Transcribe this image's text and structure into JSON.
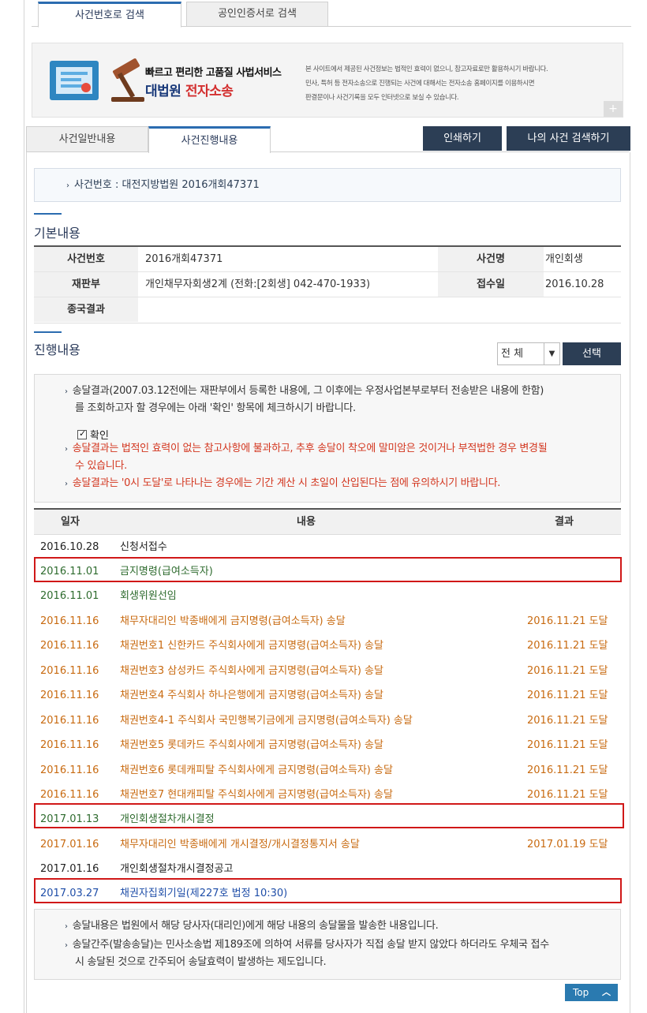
{
  "top_tabs": {
    "case_search": "사건번호로 검색",
    "cert_search": "공인인증서로 검색"
  },
  "banner": {
    "line1": "빠르고 편리한 고품질 사법서비스",
    "brand_prefix": "대법원",
    "brand_suffix": "전자소송",
    "desc1": "본 사이트에서 제공된 사건정보는 법적인 효력이 없으니, 참고자료로만 활용하시기 바랍니다.",
    "desc2": "민사, 특허 등 전자소송으로 진행되는 사건에 대해서는 전자소송 홈페이지를 이용하시면",
    "desc3": "판결문이나 사건기록을 모두 인터넷으로 보실 수 있습니다.",
    "plus": "+"
  },
  "sub_tabs": {
    "general": "사건일반내용",
    "progress": "사건진행내용"
  },
  "buttons": {
    "print": "인쇄하기",
    "my_search": "나의 사건 검색하기",
    "select": "선택",
    "top": "Top"
  },
  "case_box": "사건번호 : 대전지방법원 2016개회47371",
  "basic": {
    "title": "기본내용",
    "rows": [
      {
        "label1": "사건번호",
        "value1": "2016개회47371",
        "label2": "사건명",
        "value2": "개인회생"
      },
      {
        "label1": "재판부",
        "value1": "개인채무자회생2계 (전화:[2회생] 042-470-1933)",
        "label2": "접수일",
        "value2": "2016.10.28"
      },
      {
        "label1": "종국결과",
        "value1": "",
        "label2": "",
        "value2": ""
      }
    ]
  },
  "progress": {
    "title": "진행내용",
    "filter_value": "전 체",
    "notes": {
      "n1a": "송달결과(2007.03.12전에는 재판부에서 등록한 내용에, 그 이후에는 우정사업본부로부터 전송받은 내용에 한함)",
      "n1b": "를 조회하고자 할 경우에는 아래 '확인' 항목에 체크하시기 바랍니다.",
      "check_label": "확인",
      "n2a": "송달결과는 법적인 효력이 없는 참고사항에 불과하고, 추후 송달이 착오에 말미암은 것이거나 부적법한 경우 변경될",
      "n2b": "수 있습니다.",
      "n3": "송달결과는 '0시 도달'로 나타나는 경우에는 기간 계산 시 초일이 산입된다는 점에 유의하시기 바랍니다."
    },
    "columns": {
      "date": "일자",
      "content": "내용",
      "result": "결과"
    },
    "rows": [
      {
        "date": "2016.10.28",
        "content": "신청서접수",
        "result": "",
        "color": "black"
      },
      {
        "date": "2016.11.01",
        "content": "금지명령(급여소득자)",
        "result": "",
        "color": "green"
      },
      {
        "date": "2016.11.01",
        "content": "회생위원선임",
        "result": "",
        "color": "green"
      },
      {
        "date": "2016.11.16",
        "content": "채무자대리인 박종배에게 금지명령(급여소득자) 송달",
        "result": "2016.11.21 도달",
        "color": "orange"
      },
      {
        "date": "2016.11.16",
        "content": "채권번호1 신한카드 주식회사에게 금지명령(급여소득자) 송달",
        "result": "2016.11.21 도달",
        "color": "orange"
      },
      {
        "date": "2016.11.16",
        "content": "채권번호3 삼성카드 주식회사에게 금지명령(급여소득자) 송달",
        "result": "2016.11.21 도달",
        "color": "orange"
      },
      {
        "date": "2016.11.16",
        "content": "채권번호4 주식회사 하나은행에게 금지명령(급여소득자) 송달",
        "result": "2016.11.21 도달",
        "color": "orange"
      },
      {
        "date": "2016.11.16",
        "content": "채권번호4-1 주식회사 국민행복기금에게 금지명령(급여소득자) 송달",
        "result": "2016.11.21 도달",
        "color": "orange"
      },
      {
        "date": "2016.11.16",
        "content": "채권번호5 롯데카드 주식회사에게 금지명령(급여소득자) 송달",
        "result": "2016.11.21 도달",
        "color": "orange"
      },
      {
        "date": "2016.11.16",
        "content": "채권번호6 롯데캐피탈 주식회사에게 금지명령(급여소득자) 송달",
        "result": "2016.11.21 도달",
        "color": "orange"
      },
      {
        "date": "2016.11.16",
        "content": "채권번호7 현대캐피탈 주식회사에게 금지명령(급여소득자) 송달",
        "result": "2016.11.21 도달",
        "color": "orange"
      },
      {
        "date": "2017.01.13",
        "content": "개인회생절차개시결정",
        "result": "",
        "color": "green"
      },
      {
        "date": "2017.01.16",
        "content": "채무자대리인 박종배에게 개시결정/개시결정통지서 송달",
        "result": "2017.01.19 도달",
        "color": "orange"
      },
      {
        "date": "2017.01.16",
        "content": "개인회생절차개시결정공고",
        "result": "",
        "color": "black"
      },
      {
        "date": "2017.03.27",
        "content": "채권자집회기일(제227호 법정 10:30)",
        "result": "",
        "color": "blue"
      }
    ]
  },
  "footer_notes": {
    "f1": "송달내용은 법원에서 해당 당사자(대리인)에게 해당 내용의 송달물을 발송한 내용입니다.",
    "f2a": "송달간주(발송송달)는 민사소송법 제189조에 의하여 서류를 당사자가 직접 송달 받지 않았다 하더라도 우체국 접수",
    "f2b": "시 송달된 것으로 간주되어 송달효력이 발생하는 제도입니다."
  },
  "colors": {
    "accent": "#2b6cb0",
    "dark_button": "#2c3e55",
    "highlight": "#d01818",
    "orange": "#c86a10",
    "green": "#2e6b2e",
    "blue": "#1f4ea8"
  }
}
